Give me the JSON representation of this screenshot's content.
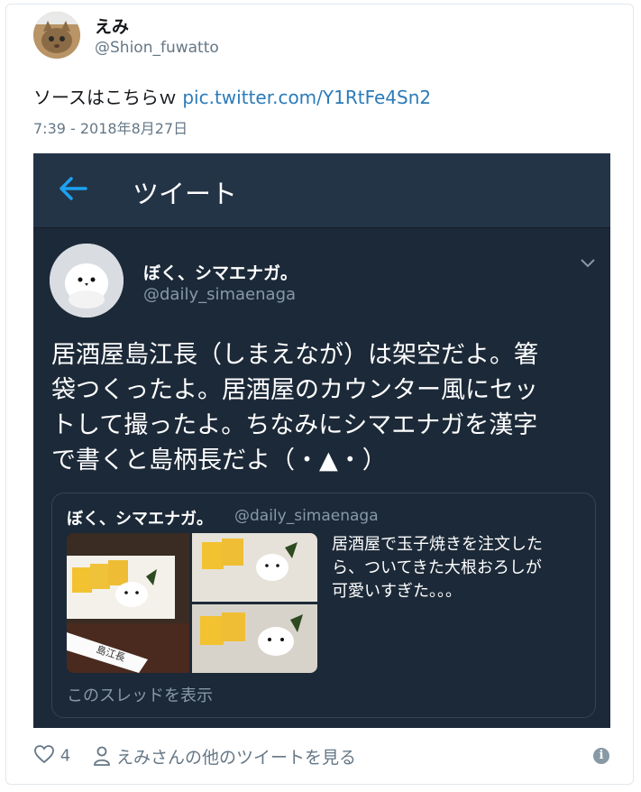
{
  "tweet": {
    "author_name": "えみ",
    "author_handle": "@Shion_fuwatto",
    "text": "ソースはこちらｗ ",
    "link": "pic.twitter.com/Y1RtFe4Sn2",
    "timestamp": "7:39 - 2018年8月27日",
    "likes": "4",
    "more_tweets": "えみさんの他のツイートを見る"
  },
  "screenshot": {
    "header_title": "ツイート",
    "author_name": "ぼく、シマエナガ。",
    "author_handle": "@daily_simaenaga",
    "text_lines": [
      "居酒屋島江長（しまえなが）は架空だよ。箸",
      "袋つくったよ。居酒屋のカウンター風にセッ",
      "トして撮ったよ。ちなみにシマエナガを漢字",
      "で書くと島柄長だよ（・▲・）"
    ],
    "quote": {
      "author_name": "ぼく、シマエナガ。",
      "author_handle": "@daily_simaenaga",
      "text_lines": [
        "居酒屋で玉子焼きを注文した",
        "ら、ついてきた大根おろしが",
        "可愛いすぎた。。。"
      ],
      "thread_link": "このスレッドを表示",
      "chopstick_wrapper_text": "島江長"
    }
  },
  "colors": {
    "link": "#2b7bb9",
    "dark_bg": "#1c2938",
    "accent": "#1da1f2"
  }
}
